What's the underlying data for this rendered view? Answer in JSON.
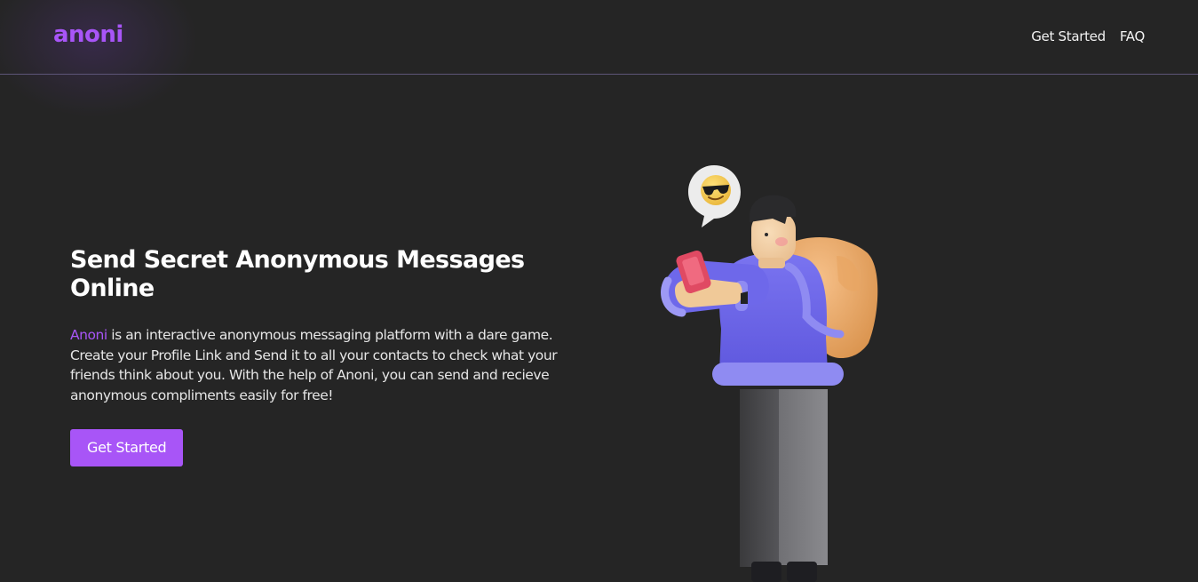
{
  "header": {
    "logo": "anoni",
    "nav": [
      {
        "label": "Get Started"
      },
      {
        "label": "FAQ"
      }
    ]
  },
  "hero": {
    "title": "Send Secret Anonymous Messages Online",
    "description_brand": "Anoni",
    "description_rest": " is an interactive anonymous messaging platform with a dare game. Create your Profile Link and Send it to all your contacts to check what your friends think about you. With the help of Anoni, you can send and recieve anonymous compliments easily for free!",
    "cta_label": "Get Started"
  },
  "illustration": {
    "icon": "person-texting-illustration",
    "bubble_icon": "sunglasses-emoji-icon"
  },
  "colors": {
    "background": "#252525",
    "accent": "#a855f7",
    "divider": "#5d5578",
    "text": "#f2f2f2"
  }
}
